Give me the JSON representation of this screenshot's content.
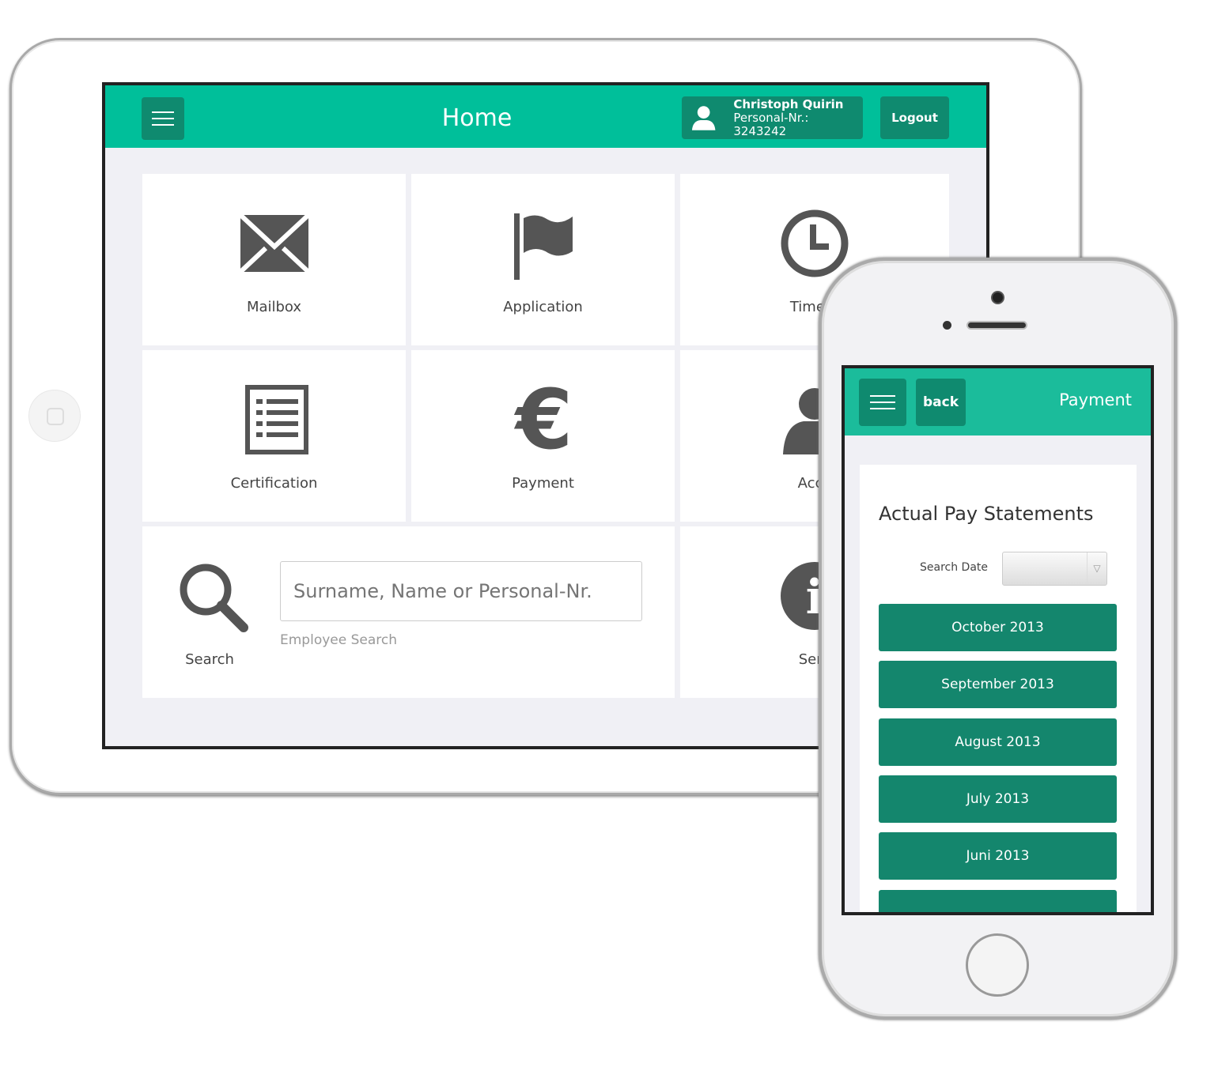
{
  "tablet": {
    "header": {
      "title": "Home",
      "user_name": "Christoph Quirin",
      "personal_nr": "Personal-Nr.: 3243242",
      "logout": "Logout"
    },
    "tiles": [
      {
        "label": "Mailbox",
        "icon": "envelope-icon"
      },
      {
        "label": "Application",
        "icon": "flag-icon"
      },
      {
        "label": "Time R",
        "icon": "clock-icon"
      },
      {
        "label": "Certification",
        "icon": "list-document-icon"
      },
      {
        "label": "Payment",
        "icon": "euro-icon"
      },
      {
        "label": "Acco",
        "icon": "user-icon"
      },
      {
        "label": "Serv",
        "icon": "info-icon"
      }
    ],
    "search": {
      "label": "Search",
      "placeholder": "Surname, Name or Personal-Nr.",
      "help": "Employee Search"
    }
  },
  "phone": {
    "header": {
      "back": "back",
      "title": "Payment"
    },
    "card": {
      "title": "Actual Pay Statements",
      "search_date_label": "Search Date",
      "search_date_value": ""
    },
    "months": [
      "October 2013",
      "September 2013",
      "August 2013",
      "July 2013",
      "Juni 2013",
      ""
    ]
  },
  "colors": {
    "header": "#00bf9a",
    "button_dark": "#0f8a6f",
    "month_button": "#14866d"
  }
}
